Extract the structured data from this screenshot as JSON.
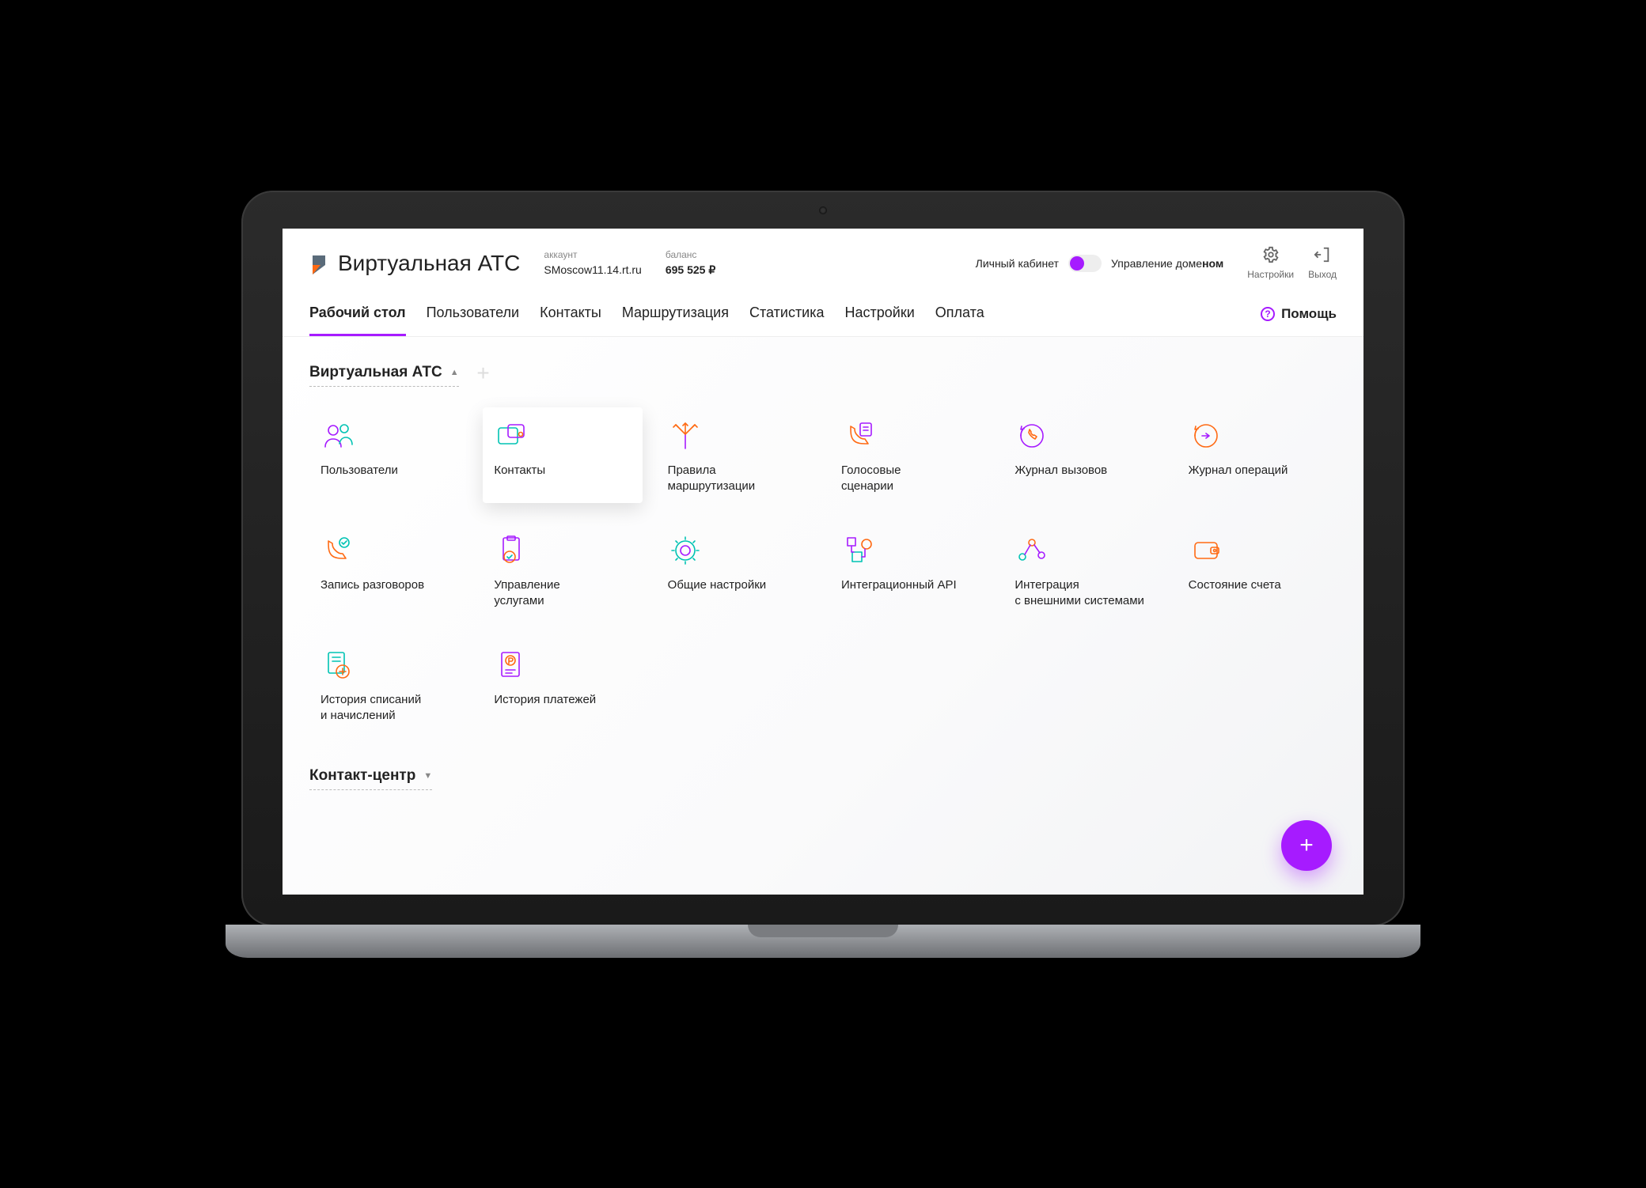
{
  "header": {
    "app_title": "Виртуальная АТС",
    "account_label": "аккаунт",
    "account_value": "SMoscow11.14.rt.ru",
    "balance_label": "баланс",
    "balance_value": "695 525 ₽",
    "mode_left": "Личный кабинет",
    "mode_right_plain": "Управление доме",
    "mode_right_bold": "ном",
    "settings_label": "Настройки",
    "logout_label": "Выход"
  },
  "tabs": {
    "items": [
      "Рабочий стол",
      "Пользователи",
      "Контакты",
      "Маршрутизация",
      "Статистика",
      "Настройки",
      "Оплата"
    ],
    "help": "Помощь"
  },
  "section1": {
    "title": "Виртуальная АТС",
    "tiles": [
      {
        "label": "Пользователи",
        "label2": ""
      },
      {
        "label": "Контакты",
        "label2": ""
      },
      {
        "label": "Правила",
        "label2": "маршрутизации"
      },
      {
        "label": "Голосовые",
        "label2": "сценарии"
      },
      {
        "label": "Журнал вызовов",
        "label2": ""
      },
      {
        "label": "Журнал операций",
        "label2": ""
      },
      {
        "label": "Запись разговоров",
        "label2": ""
      },
      {
        "label": "Управление",
        "label2": "услугами"
      },
      {
        "label": "Общие настройки",
        "label2": ""
      },
      {
        "label": "Интеграционный API",
        "label2": ""
      },
      {
        "label": "Интеграция",
        "label2": "с внешними системами"
      },
      {
        "label": "Состояние счета",
        "label2": ""
      },
      {
        "label": "История списаний",
        "label2": "и начислений"
      },
      {
        "label": "История платежей",
        "label2": ""
      }
    ]
  },
  "section2": {
    "title": "Контакт-центр"
  },
  "colors": {
    "purple": "#a61bff",
    "orange": "#ff6a13",
    "teal": "#00c3b3"
  }
}
